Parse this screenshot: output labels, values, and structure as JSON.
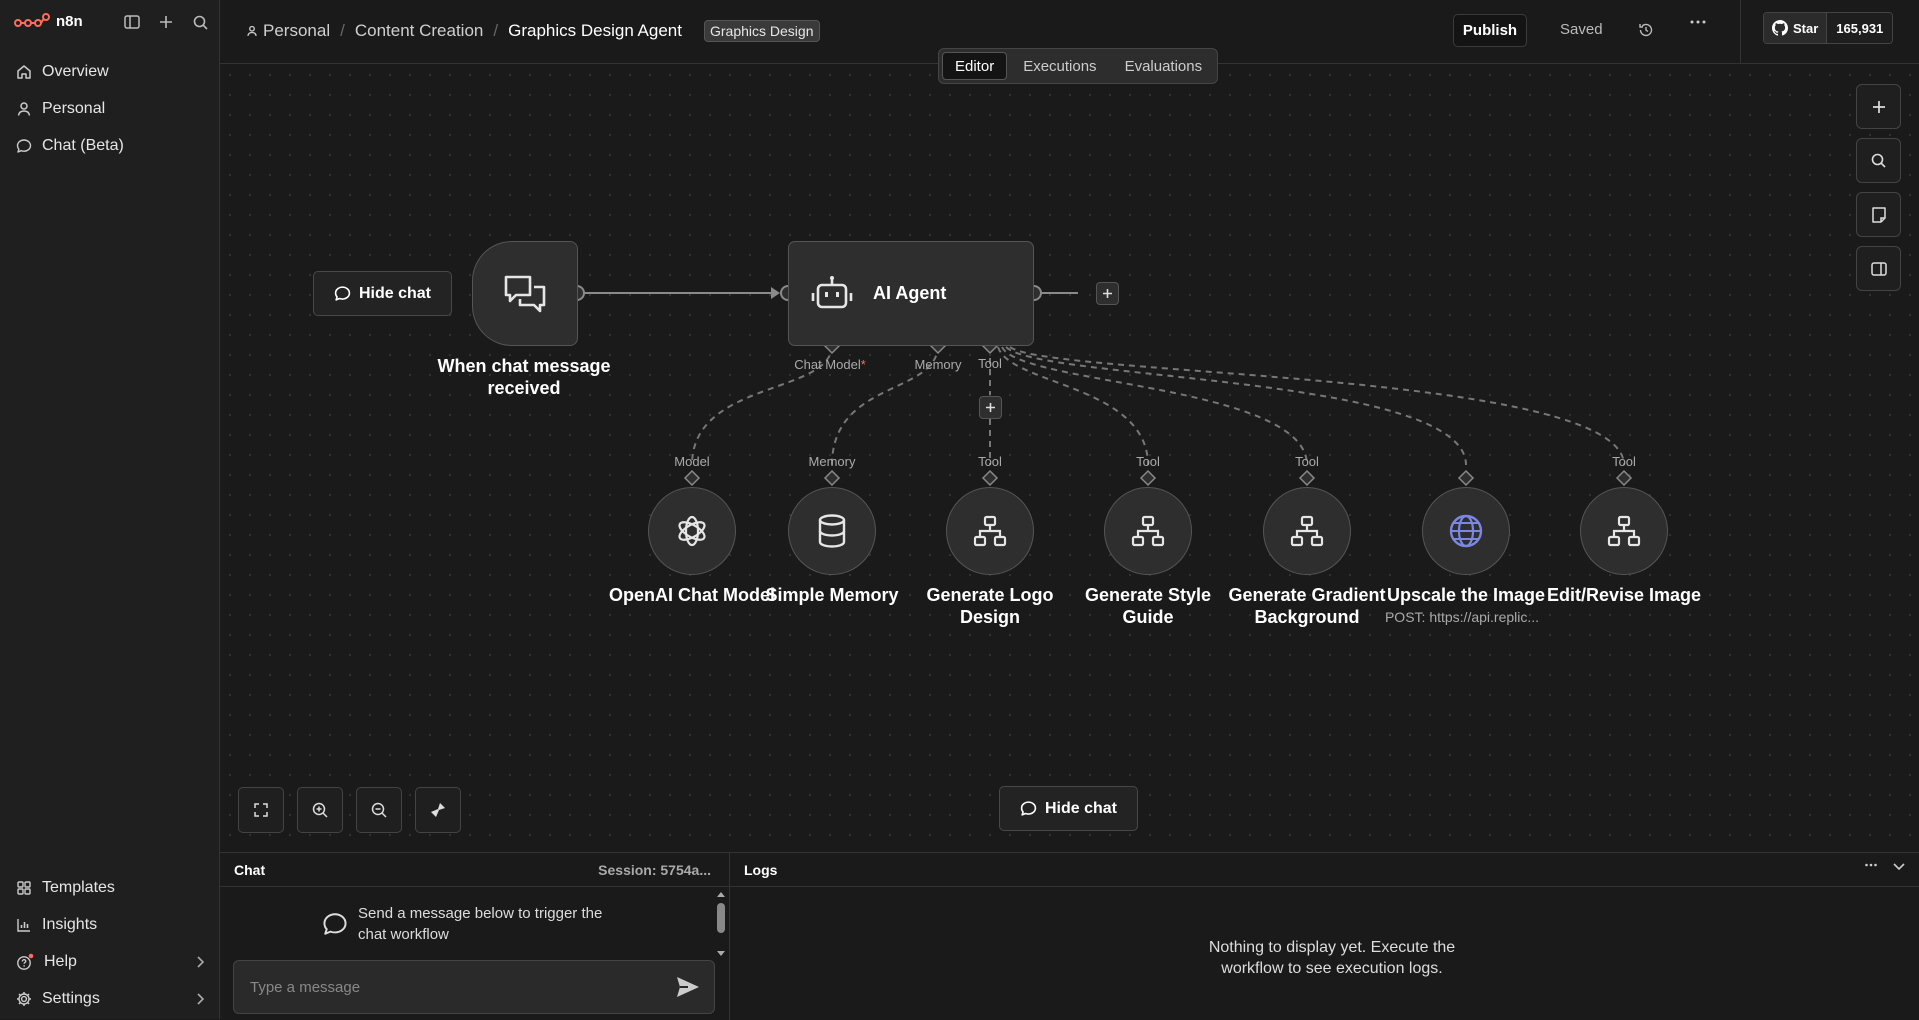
{
  "app": {
    "name": "n8n"
  },
  "sidebar": {
    "items": [
      {
        "label": "Overview",
        "icon": "home-icon"
      },
      {
        "label": "Personal",
        "icon": "user-icon"
      },
      {
        "label": "Chat (Beta)",
        "icon": "chat-icon"
      }
    ],
    "bottom_items": [
      {
        "label": "Templates",
        "icon": "templates-icon"
      },
      {
        "label": "Insights",
        "icon": "chart-icon"
      },
      {
        "label": "Help",
        "icon": "help-icon",
        "has_notification": true
      },
      {
        "label": "Settings",
        "icon": "gear-icon"
      }
    ]
  },
  "header": {
    "breadcrumbs": [
      "Personal",
      "Content Creation",
      "Graphics Design Agent"
    ],
    "tag": "Graphics Design",
    "publish_label": "Publish",
    "saved_label": "Saved",
    "github": {
      "star_label": "Star",
      "count": "165,931"
    }
  },
  "tabs": [
    {
      "label": "Editor",
      "active": true
    },
    {
      "label": "Executions",
      "active": false
    },
    {
      "label": "Evaluations",
      "active": false
    }
  ],
  "canvas": {
    "hide_chat_label": "Hide chat",
    "trigger": {
      "label": "When chat message received",
      "icon": "chat-bubbles-icon"
    },
    "agent": {
      "label": "AI Agent",
      "icon": "robot-icon",
      "ports": {
        "chat_model": "Chat Model",
        "required_mark": "*",
        "memory": "Memory",
        "tool": "Tool"
      }
    },
    "subnodes": [
      {
        "port": "Model",
        "label": "OpenAI Chat Model",
        "icon": "openai-icon",
        "subtitle": ""
      },
      {
        "port": "Memory",
        "label": "Simple Memory",
        "icon": "database-icon",
        "subtitle": ""
      },
      {
        "port": "Tool",
        "label": "Generate Logo Design",
        "icon": "workflow-icon",
        "subtitle": ""
      },
      {
        "port": "Tool",
        "label": "Generate Style Guide",
        "icon": "workflow-icon",
        "subtitle": ""
      },
      {
        "port": "Tool",
        "label": "Generate Gradient Background",
        "icon": "workflow-icon",
        "subtitle": ""
      },
      {
        "port": "",
        "label": "Upscale the Image",
        "icon": "globe-icon",
        "subtitle": "POST: https://api.replic..."
      },
      {
        "port": "Tool",
        "label": "Edit/Revise Image",
        "icon": "workflow-icon",
        "subtitle": ""
      }
    ]
  },
  "chat_panel": {
    "title": "Chat",
    "session": "Session: 5754a...",
    "empty_message": "Send a message below to trigger the chat workflow",
    "input_placeholder": "Type a message"
  },
  "logs_panel": {
    "title": "Logs",
    "empty_message": "Nothing to display yet. Execute the workflow to see execution logs."
  },
  "colors": {
    "accent": "#ff6d5a",
    "background": "#1a1a1a",
    "node": "#2e2e2e",
    "globe": "#7b87e0"
  }
}
